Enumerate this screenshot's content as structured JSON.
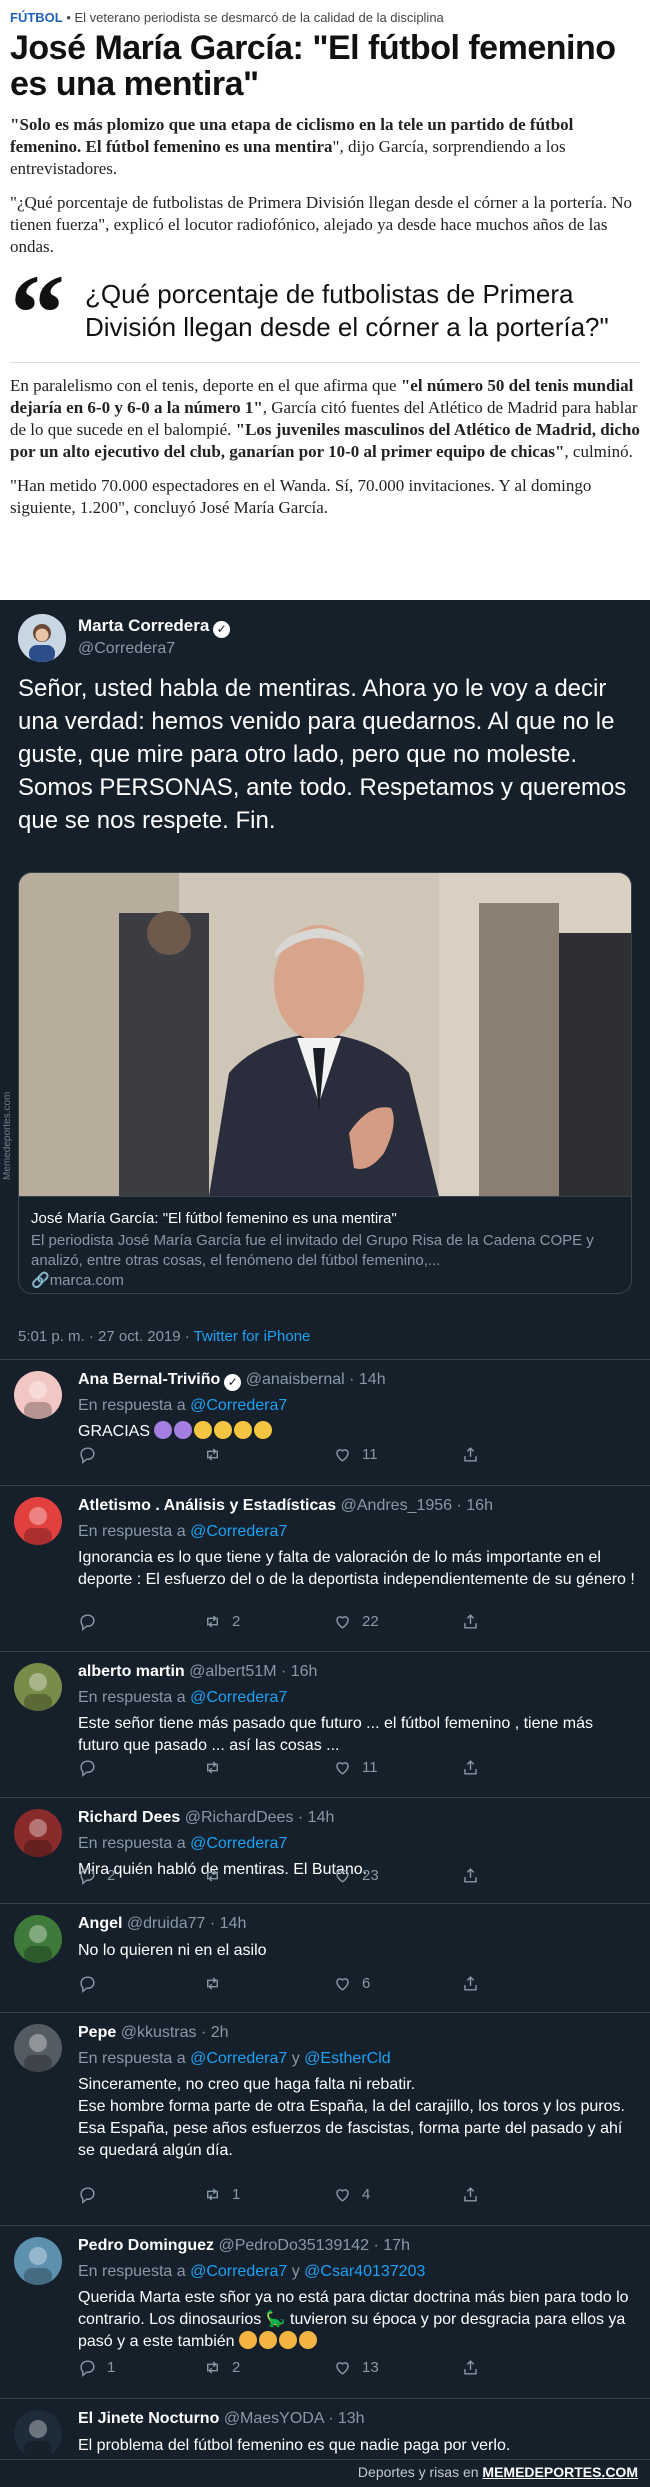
{
  "article": {
    "section": "FÚTBOL",
    "kicker": "El veterano periodista se desmarcó de la calidad de la disciplina",
    "headline": "José María García: \"El fútbol femenino es una mentira\"",
    "p1_bold": "\"Solo es más plomizo que una etapa de ciclismo en la tele un partido de fútbol femenino. El fútbol femenino es una mentira",
    "p1_rest": "\", dijo García, sorprendiendo a los entrevistadores.",
    "p2": "\"¿Qué porcentaje de futbolistas de Primera División llegan desde el córner a la portería. No tienen fuerza\", explicó el locutor radiofónico, alejado ya desde hace muchos años de las ondas.",
    "quote_mark": "“",
    "quote": "¿Qué porcentaje de futbolistas de Primera División llegan desde el córner a la portería?\"",
    "p3_a": "En paralelismo con el tenis, deporte en el que afirma que ",
    "p3_b": "\"el número 50 del tenis mundial dejaría en 6-0 y 6-0 a la número 1\"",
    "p3_c": ", García citó fuentes del Atlético de Madrid para hablar de lo que sucede en el balompié. ",
    "p3_d": "\"Los juveniles masculinos del Atlético de Madrid, dicho por un alto ejecutivo del club, ganarían por 10-0 al primer equipo de chicas\"",
    "p3_e": ", culminó.",
    "p4": "\"Han metido 70.000 espectadores en el Wanda. Sí, 70.000 invitaciones. Y al domingo siguiente, 1.200\", concluyó José María García."
  },
  "tweet": {
    "name": "Marta Corredera",
    "handle": "@Corredera7",
    "text": "Señor, usted habla de mentiras. Ahora yo le voy a decir una verdad: hemos venido para quedarnos. Al que no le guste, que mire para otro lado, pero que no moleste. Somos PERSONAS, ante todo. Respetamos y queremos que se nos respete. Fin.",
    "card_title": "José María García: \"El fútbol femenino es una mentira\"",
    "card_desc": "El periodista José María García fue el invitado del Grupo Risa de la Cadena COPE y analizó, entre otras cosas, el fenómeno del fútbol femenino,...",
    "card_link": "marca.com",
    "time": "5:01 p. m. · 27 oct. 2019 · ",
    "source": "Twitter for iPhone",
    "watermark": "Memedeportes.com"
  },
  "replies": [
    {
      "name": "Ana Bernal-Triviño",
      "verified": true,
      "handle": "@anaisbernal · 14h",
      "reply_to": "@Corredera7",
      "reply_to2": "",
      "text": "GRACIAS",
      "reply": "",
      "retweet": "",
      "like": "11"
    },
    {
      "name": "Atletismo . Análisis y Estadísticas",
      "verified": false,
      "handle": "@Andres_1956 · 16h",
      "reply_to": "@Corredera7",
      "reply_to2": "",
      "text": "Ignorancia es lo que tiene y falta de valoración de lo más importante en el deporte : El esfuerzo del o de la deportista independientemente de su género  !",
      "reply": "",
      "retweet": "2",
      "like": "22"
    },
    {
      "name": "alberto martin",
      "verified": false,
      "handle": "@albert51M · 16h",
      "reply_to": "@Corredera7",
      "reply_to2": "",
      "text": "Este señor tiene más pasado que futuro ... el fútbol femenino , tiene más futuro que pasado ... así las cosas ...",
      "reply": "",
      "retweet": "",
      "like": "11"
    },
    {
      "name": "Richard Dees",
      "verified": false,
      "handle": "@RichardDees · 14h",
      "reply_to": "@Corredera7",
      "reply_to2": "",
      "text": "Mira quién habló de mentiras. El Butano.",
      "reply": "2",
      "retweet": "",
      "like": "23"
    },
    {
      "name": "Angel",
      "verified": false,
      "handle": "@druida77 · 14h",
      "reply_to": "",
      "reply_to2": "",
      "text": "No lo quieren ni en el asilo",
      "reply": "",
      "retweet": "",
      "like": "6"
    },
    {
      "name": "Pepe",
      "verified": false,
      "handle": "@kkustras · 2h",
      "reply_to": "@Corredera7",
      "reply_to2": "@EstherCld",
      "text": "Sinceramente, no creo que haga falta ni rebatir.\nEse hombre forma parte de otra España, la del carajillo,  los toros y los puros.\nEsa España, pese años esfuerzos de fascistas, forma parte del pasado y ahí se quedará algún día.",
      "reply": "",
      "retweet": "1",
      "like": "4"
    },
    {
      "name": "Pedro Dominguez",
      "verified": false,
      "handle": "@PedroDo35139142 · 17h",
      "reply_to": "@Corredera7",
      "reply_to2": "@Csar40137203",
      "text": "Querida Marta este sñor ya no está para dictar doctrina más bien para todo lo contrario. Los dinosaurios 🦕 tuvieron su época y por desgracia para ellos ya pasó y a este también",
      "reply": "1",
      "retweet": "2",
      "like": "13"
    },
    {
      "name": "El Jinete Nocturno",
      "verified": false,
      "handle": "@MaesYODA · 13h",
      "reply_to": "",
      "reply_to2": "",
      "text": "El problema del fútbol femenino es que nadie paga por verlo.",
      "reply": "",
      "retweet": "",
      "like": ""
    }
  ],
  "labels": {
    "in_reply_to": "En respuesta a",
    "and": "y"
  },
  "footer": {
    "prefix": "Deportes y risas en ",
    "brand": "MEMEDEPORTES.COM"
  },
  "colors": {
    "twitter_bg": "#15202b",
    "link": "#1da1f2",
    "muted": "#8899a6",
    "section": "#1e63b9"
  }
}
